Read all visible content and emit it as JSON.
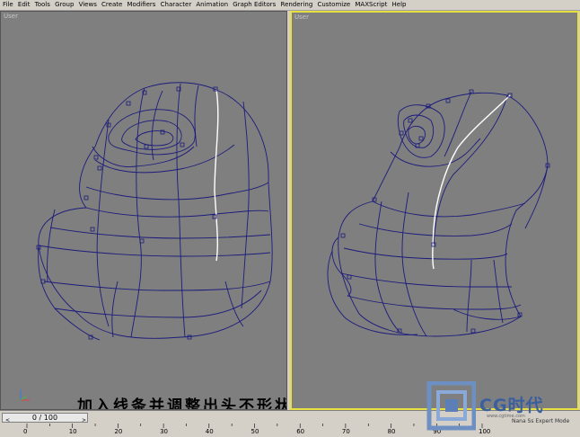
{
  "menu": [
    "File",
    "Edit",
    "Tools",
    "Group",
    "Views",
    "Create",
    "Modifiers",
    "Character",
    "Animation",
    "Graph Editors",
    "Rendering",
    "Customize",
    "MAXScript",
    "Help"
  ],
  "viewports": {
    "left": {
      "label": "User"
    },
    "right": {
      "label": "User"
    }
  },
  "caption": "加入线条并调整出头不形状",
  "timeline": {
    "frame_display": "0 / 100",
    "prev_arrow": "<",
    "next_arrow": ">",
    "ruler_ticks": [
      "0",
      "10",
      "20",
      "30",
      "40",
      "50",
      "60",
      "70",
      "80",
      "90",
      "100"
    ]
  },
  "watermark": {
    "brand": "CG时代",
    "url": "www.cgtime.com",
    "status_text": "Nana Ss Expert Mode"
  },
  "colors": {
    "viewport_bg": "#7f7f7f",
    "wire": "#1c1c7c",
    "active_border": "#e8e040",
    "highlight_edge": "#ffffff",
    "ui_bg": "#d4d0c8"
  }
}
